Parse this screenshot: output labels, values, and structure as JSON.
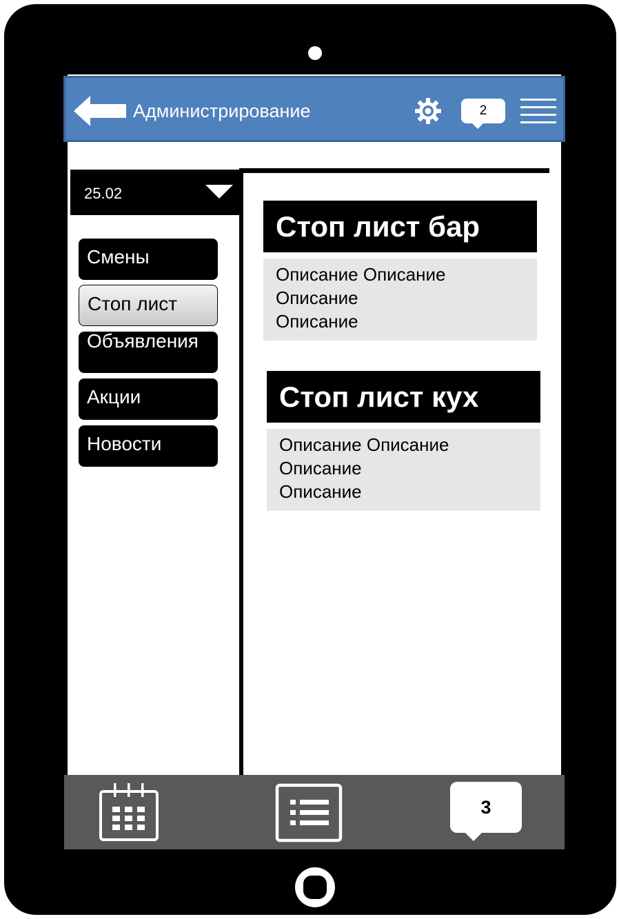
{
  "header": {
    "title": "Администрирование",
    "notifications_count": "2"
  },
  "date_select": {
    "value": "25.02"
  },
  "sidebar": {
    "items": [
      {
        "label": "Смены",
        "active": false
      },
      {
        "label": "Стоп лист",
        "active": true
      },
      {
        "label": "Объявления",
        "active": false
      },
      {
        "label": "Акции",
        "active": false
      },
      {
        "label": "Новости",
        "active": false
      }
    ]
  },
  "cards": [
    {
      "title": "Стоп лист бар",
      "lines": [
        "Описание Описание",
        "Описание",
        "Описание"
      ]
    },
    {
      "title": "Стоп лист кух",
      "lines": [
        "Описание Описание",
        "Описание",
        "Описание"
      ]
    }
  ],
  "footer": {
    "messages_count": "3"
  },
  "icons": {
    "back": "arrow-left-icon",
    "settings": "gear-icon",
    "menu": "hamburger-menu-icon",
    "calendar": "calendar-icon",
    "list": "list-icon",
    "chat": "chat-bubble-icon"
  },
  "colors": {
    "header": "#4f81bd",
    "footer": "#595959",
    "description_bg": "#e6e6e6"
  }
}
